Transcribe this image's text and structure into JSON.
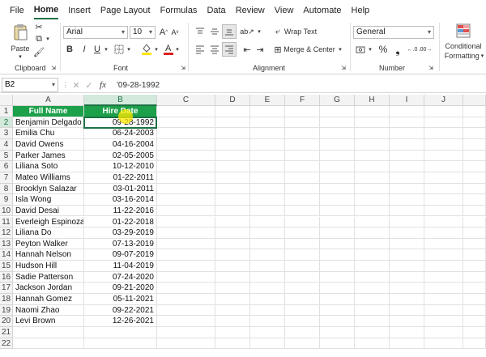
{
  "menu": [
    "File",
    "Home",
    "Insert",
    "Page Layout",
    "Formulas",
    "Data",
    "Review",
    "View",
    "Automate",
    "Help"
  ],
  "ribbon": {
    "paste_label": "Paste",
    "clipboard_label": "Clipboard",
    "font_name": "Arial",
    "font_size": "10",
    "font_label": "Font",
    "bold": "B",
    "italic": "I",
    "underline": "U",
    "wrap_text": "Wrap Text",
    "merge_center": "Merge & Center",
    "alignment_label": "Alignment",
    "number_format": "General",
    "number_label": "Number",
    "conditional_formatting_line1": "Conditional",
    "conditional_formatting_line2": "Formatting"
  },
  "formula_bar": {
    "name_box": "B2",
    "formula": "'09-28-1992",
    "fx": "fx"
  },
  "columns": [
    "A",
    "B",
    "C",
    "D",
    "E",
    "F",
    "G",
    "H",
    "I",
    "J"
  ],
  "headers": {
    "full_name": "Full Name",
    "hire_date": "Hire Date"
  },
  "rows": [
    {
      "name": "Benjamin Delgado",
      "date": "09-28-1992"
    },
    {
      "name": "Emilia Chu",
      "date": "06-24-2003"
    },
    {
      "name": "David Owens",
      "date": "04-16-2004"
    },
    {
      "name": "Parker James",
      "date": "02-05-2005"
    },
    {
      "name": "Liliana Soto",
      "date": "10-12-2010"
    },
    {
      "name": "Mateo Williams",
      "date": "01-22-2011"
    },
    {
      "name": "Brooklyn Salazar",
      "date": "03-01-2011"
    },
    {
      "name": "Isla Wong",
      "date": "03-16-2014"
    },
    {
      "name": "David Desai",
      "date": "11-22-2016"
    },
    {
      "name": "Everleigh Espinoza",
      "date": "01-22-2018"
    },
    {
      "name": "Liliana Do",
      "date": "03-29-2019"
    },
    {
      "name": "Peyton Walker",
      "date": "07-13-2019"
    },
    {
      "name": "Hannah Nelson",
      "date": "09-07-2019"
    },
    {
      "name": "Hudson Hill",
      "date": "11-04-2019"
    },
    {
      "name": "Sadie Patterson",
      "date": "07-24-2020"
    },
    {
      "name": "Jackson Jordan",
      "date": "09-21-2020"
    },
    {
      "name": "Hannah Gomez",
      "date": "05-11-2021"
    },
    {
      "name": "Naomi Zhao",
      "date": "09-22-2021"
    },
    {
      "name": "Levi Brown",
      "date": "12-26-2021"
    }
  ],
  "row_numbers": [
    "1",
    "2",
    "3",
    "4",
    "5",
    "6",
    "7",
    "8",
    "9",
    "10",
    "11",
    "12",
    "13",
    "14",
    "15",
    "16",
    "17",
    "18",
    "19",
    "20",
    "21",
    "22"
  ],
  "colors": {
    "header_fill": "#1ca04a",
    "accent": "#1e7145"
  }
}
